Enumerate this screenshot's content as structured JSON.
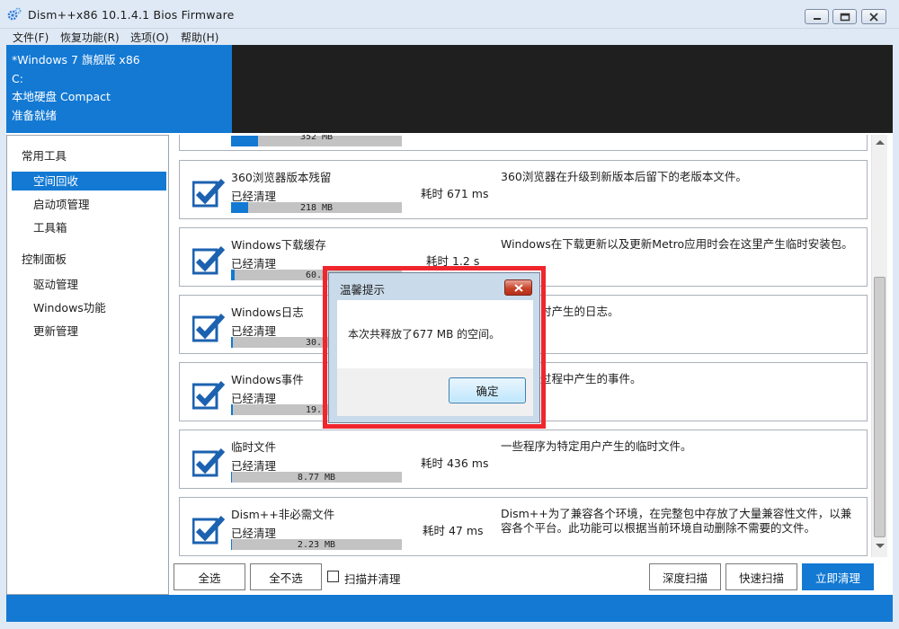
{
  "window": {
    "title": "Dism++x86 10.1.4.1 Bios Firmware",
    "icon": "gear-icon"
  },
  "menu": [
    "文件(F)",
    "恢复功能(R)",
    "选项(O)",
    "帮助(H)"
  ],
  "header": {
    "os": "*Windows 7 旗舰版 x86",
    "drive": "C:",
    "disk": "本地硬盘 Compact",
    "status": "准备就绪"
  },
  "sidebar": {
    "group1": "常用工具",
    "items1": [
      "空间回收",
      "启动项管理",
      "工具箱"
    ],
    "group2": "控制面板",
    "items2": [
      "驱动管理",
      "Windows功能",
      "更新管理"
    ]
  },
  "partial_top_size": "352 MB",
  "items": [
    {
      "title": "360浏览器版本残留",
      "status": "已经清理",
      "size": "218 MB",
      "fill": 0.1,
      "time": "耗时 671 ms",
      "desc": "360浏览器在升级到新版本后留下的老版本文件。"
    },
    {
      "title": "Windows下载缓存",
      "status": "已经清理",
      "size": "60.2",
      "fill": 0.02,
      "time": "耗时 1.2 s",
      "desc": "Windows在下载更新以及更新Metro应用时会在这里产生临时安装包。"
    },
    {
      "title": "Windows日志",
      "status": "已经清理",
      "size": "30.7",
      "fill": 0.01,
      "time": "",
      "desc": "s在运行时产生的日志。"
    },
    {
      "title": "Windows事件",
      "status": "已经清理",
      "size": "19.7",
      "fill": 0.01,
      "time": "",
      "desc": "s在运行过程中产生的事件。"
    },
    {
      "title": "临时文件",
      "status": "已经清理",
      "size": "8.77 MB",
      "fill": 0,
      "time": "耗时 436 ms",
      "desc": "一些程序为特定用户产生的临时文件。"
    },
    {
      "title": "Dism++非必需文件",
      "status": "已经清理",
      "size": "2.23 MB",
      "fill": 0,
      "time": "耗时 47 ms",
      "desc": "Dism++为了兼容各个环境，在完整包中存放了大量兼容性文件，以兼容各个平台。此功能可以根据当前环境自动删除不需要的文件。"
    }
  ],
  "buttons": {
    "select_all": "全选",
    "select_none": "全不选",
    "scan_clean": "扫描并清理",
    "deep_scan": "深度扫描",
    "quick_scan": "快速扫描",
    "clean_now": "立即清理"
  },
  "dialog": {
    "title": "温馨提示",
    "message": "本次共释放了677 MB 的空间。",
    "ok": "确定"
  },
  "colors": {
    "accent": "#1379d3",
    "header_dark": "#1f1f1f",
    "highlight_outline": "#f0262d"
  }
}
